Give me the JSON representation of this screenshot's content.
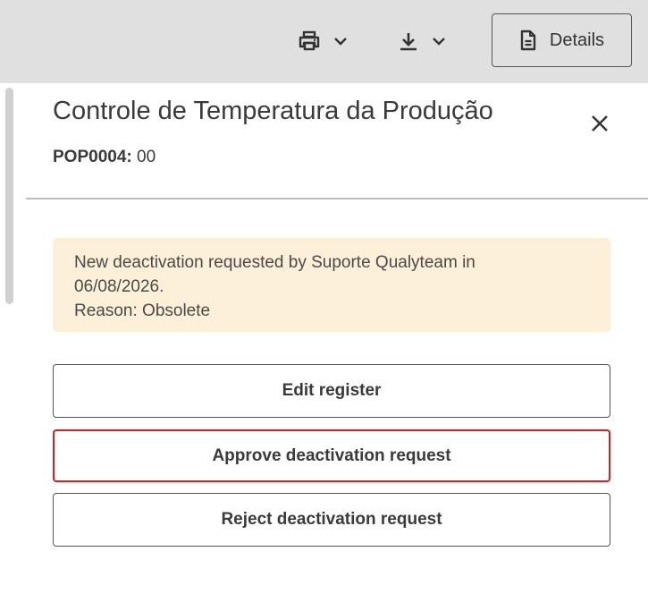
{
  "toolbar": {
    "print_icon": "print-icon",
    "download_icon": "download-icon",
    "chevron_icon": "chevron-down-icon",
    "details_icon": "document-icon",
    "details_label": "Details"
  },
  "document": {
    "title": "Controle de Temperatura da Produção",
    "code_label": "POP0004:",
    "revision": "00"
  },
  "notice": {
    "line1": "New deactivation requested by Suporte Qualyteam in",
    "line2": "06/08/2026.",
    "reason": "Reason: Obsolete",
    "background": "#fdf0d8"
  },
  "actions": {
    "edit_label": "Edit register",
    "approve_label": "Approve deactivation request",
    "reject_label": "Reject deactivation request",
    "highlight_color": "#e01b1b"
  }
}
